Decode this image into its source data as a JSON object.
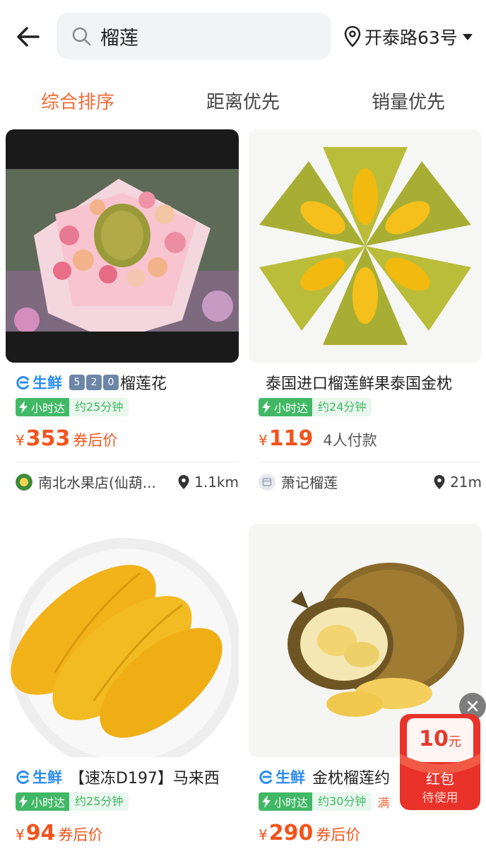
{
  "header": {
    "search_query": "榴莲",
    "location": "开泰路63号"
  },
  "tabs": [
    {
      "label": "综合排序",
      "active": true
    },
    {
      "label": "距离优先",
      "active": false
    },
    {
      "label": "销量优先",
      "active": false
    }
  ],
  "products": [
    {
      "fresh_label": "生鲜",
      "keycaps": [
        "5",
        "2",
        "0"
      ],
      "title": "榴莲花",
      "delivery_tag": "小时达",
      "eta": "约25分钟",
      "price": "353",
      "price_suffix": "券后价",
      "shop": "南北水果店(仙葫...",
      "distance": "1.1km"
    },
    {
      "title": "泰国进口榴莲鲜果泰国金枕",
      "delivery_tag": "小时达",
      "eta": "约24分钟",
      "price": "119",
      "paid_count": "4人付款",
      "shop": "萧记榴莲",
      "distance": "21m"
    },
    {
      "fresh_label": "生鲜",
      "title": "【速冻D197】马来西",
      "delivery_tag": "小时达",
      "eta": "约25分钟",
      "price": "94",
      "price_suffix": "券后价"
    },
    {
      "fresh_label": "生鲜",
      "title": "金枕榴莲约",
      "delivery_tag": "小时达",
      "eta": "约30分钟",
      "promo": "满",
      "price": "290",
      "price_suffix": "券后价"
    }
  ],
  "currency_symbol": "¥",
  "red_packet": {
    "amount": "10",
    "unit": "元",
    "title": "红包",
    "status": "待使用"
  },
  "colors": {
    "accent_orange": "#f26b35",
    "price_red": "#f2541c",
    "fresh_blue": "#2a8cf0",
    "delivery_green": "#41b865"
  },
  "icons": [
    "back-arrow-icon",
    "search-icon",
    "location-pin-icon",
    "caret-down-icon",
    "lightning-icon",
    "close-icon"
  ]
}
